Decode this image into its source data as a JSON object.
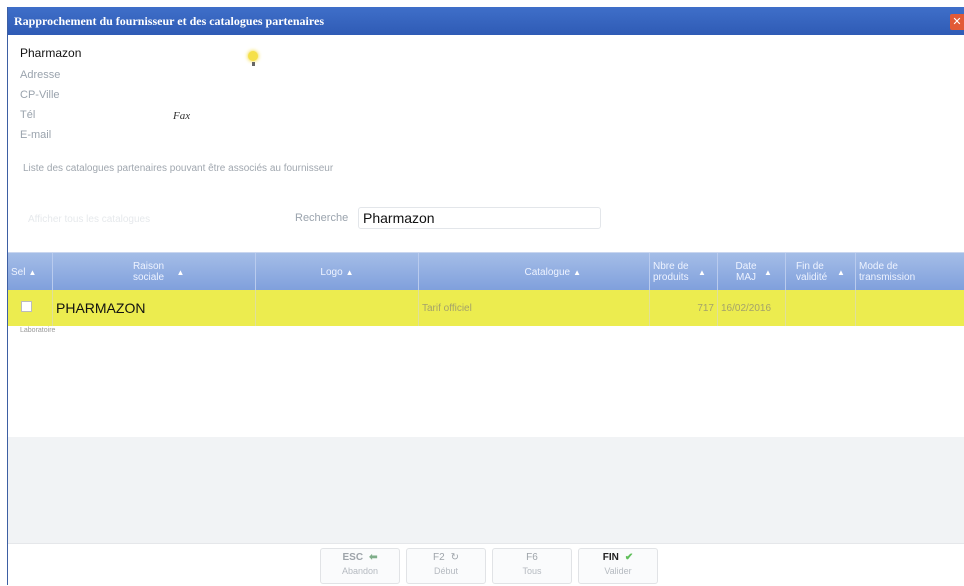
{
  "window": {
    "title": "Rapprochement du fournisseur et des catalogues partenaires",
    "close_glyph": "✕"
  },
  "supplier": {
    "name": "Pharmazon",
    "address_label": "Adresse",
    "cp_ville_label": "CP-Ville",
    "tel_label": "Tél",
    "fax_label": "Fax",
    "email_label": "E-mail"
  },
  "list_caption": "Liste des catalogues partenaires pouvant être associés au fournisseur",
  "ghost_text": "Afficher tous les catalogues",
  "search": {
    "label": "Recherche",
    "value": "Pharmazon"
  },
  "grid": {
    "columns": [
      {
        "label": "Sel"
      },
      {
        "label": "Raison sociale"
      },
      {
        "label": "Logo"
      },
      {
        "label": "Catalogue"
      },
      {
        "label": "Nbre de produits"
      },
      {
        "label": "Date MAJ"
      },
      {
        "label": "Fin de validité"
      },
      {
        "label": "Mode de transmission"
      }
    ],
    "sort_glyph": "▲",
    "rows": [
      {
        "raison_sociale": "PHARMAZON",
        "logo": "",
        "catalogue": "Tarif officiel",
        "nb_produits": "717",
        "date_maj": "16/02/2016",
        "fin_validite": "",
        "mode_transmission": ""
      }
    ],
    "below_row_text": "Laboratoire"
  },
  "buttons": [
    {
      "key": "ESC",
      "label": "Abandon",
      "icon": "back-arrow-icon"
    },
    {
      "key": "F2",
      "label": "Début",
      "icon": "refresh-icon"
    },
    {
      "key": "F6",
      "label": "Tous",
      "icon": ""
    },
    {
      "key": "FIN",
      "label": "Valider",
      "icon": "check-icon"
    }
  ],
  "colors": {
    "title_bar": "#2f5bb5",
    "selected_row": "#ecec4f",
    "header": "#8fabdf",
    "close": "#e25a36"
  }
}
